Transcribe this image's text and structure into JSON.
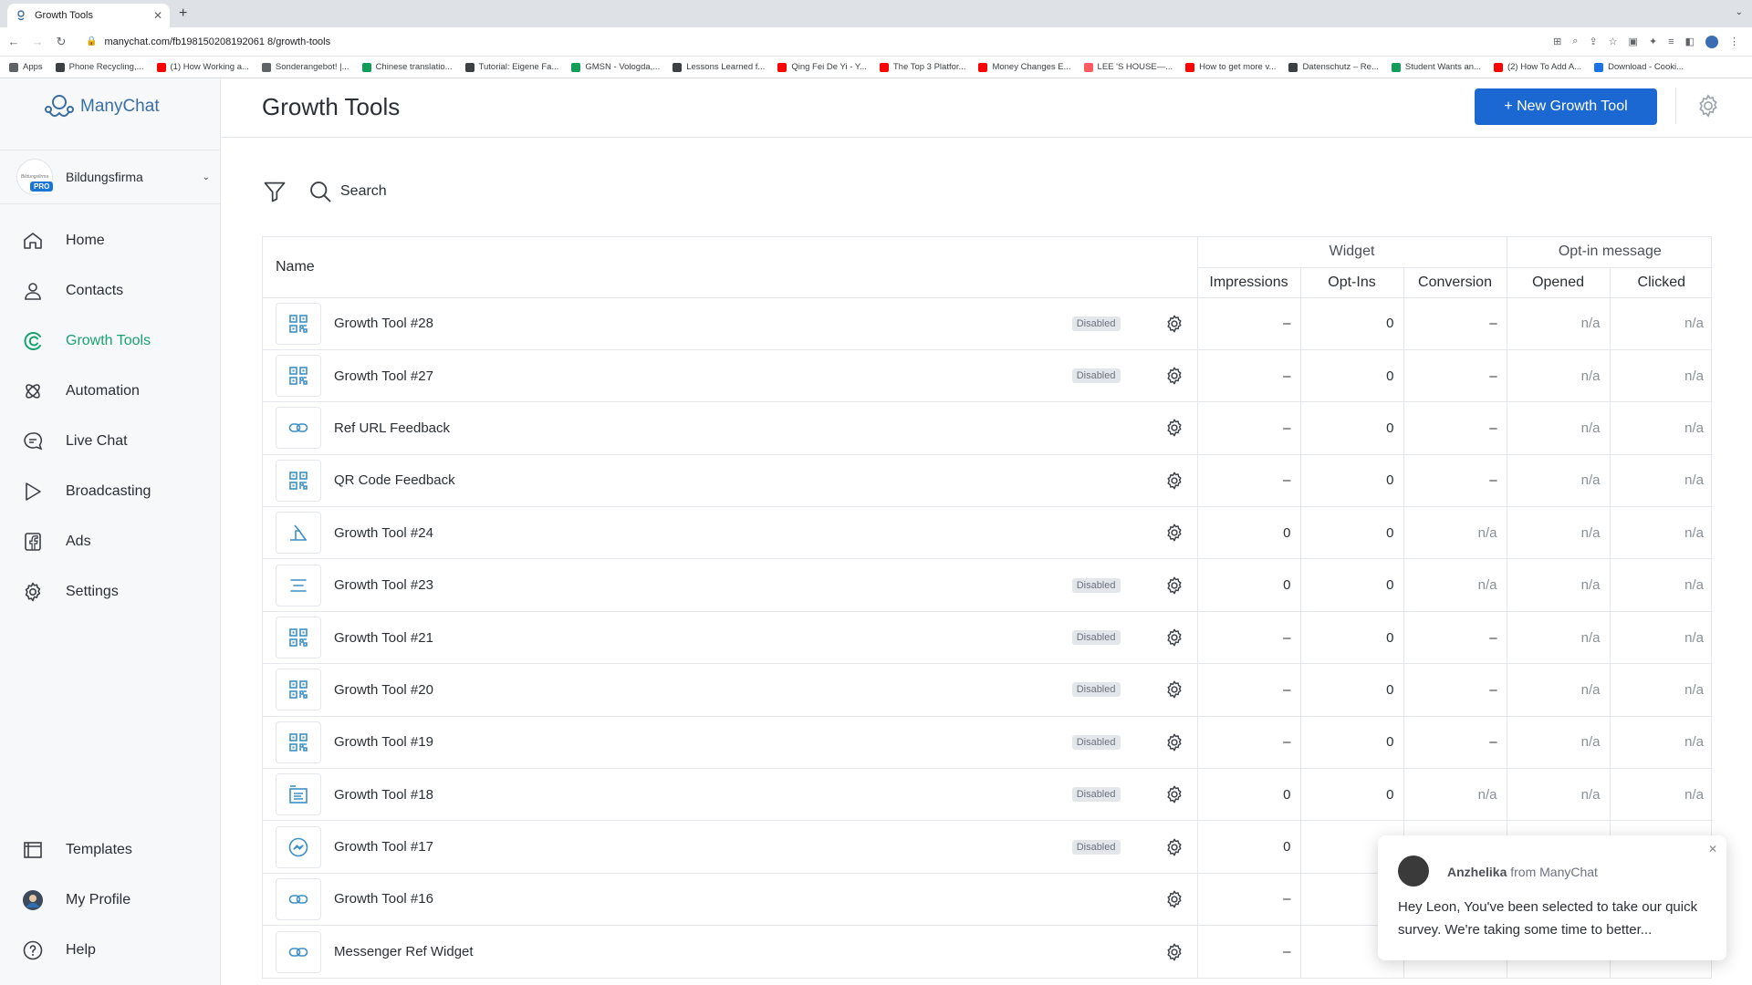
{
  "browser": {
    "tab_title": "Growth Tools",
    "url": "manychat.com/fb198150208192061 8/growth-tools",
    "bookmarks": [
      {
        "label": "Apps",
        "color": "#5f6368"
      },
      {
        "label": "Phone Recycling,...",
        "color": "#3c4043"
      },
      {
        "label": "(1) How Working a...",
        "color": "#ff0000"
      },
      {
        "label": "Sonderangebot! |...",
        "color": "#5f6368"
      },
      {
        "label": "Chinese translatio...",
        "color": "#0f9d58"
      },
      {
        "label": "Tutorial: Eigene Fa...",
        "color": "#3c4043"
      },
      {
        "label": "GMSN - Vologda,...",
        "color": "#0f9d58"
      },
      {
        "label": "Lessons Learned f...",
        "color": "#3c4043"
      },
      {
        "label": "Qing Fei De Yi - Y...",
        "color": "#ff0000"
      },
      {
        "label": "The Top 3 Platfor...",
        "color": "#ff0000"
      },
      {
        "label": "Money Changes E...",
        "color": "#ff0000"
      },
      {
        "label": "LEE 'S HOUSE—...",
        "color": "#ff5a5f"
      },
      {
        "label": "How to get more v...",
        "color": "#ff0000"
      },
      {
        "label": "Datenschutz – Re...",
        "color": "#3c4043"
      },
      {
        "label": "Student Wants an...",
        "color": "#0f9d58"
      },
      {
        "label": "(2) How To Add A...",
        "color": "#ff0000"
      },
      {
        "label": "Download - Cooki...",
        "color": "#1a73e8"
      }
    ]
  },
  "sidebar": {
    "brand": "ManyChat",
    "account": {
      "name": "Bildungsfirma",
      "badge": "PRO",
      "logo_text": "Bildungsfirma"
    },
    "nav": [
      {
        "label": "Home",
        "icon": "home-icon"
      },
      {
        "label": "Contacts",
        "icon": "user-icon"
      },
      {
        "label": "Growth Tools",
        "icon": "growth-icon",
        "active": true
      },
      {
        "label": "Automation",
        "icon": "automation-icon"
      },
      {
        "label": "Live Chat",
        "icon": "chat-icon"
      },
      {
        "label": "Broadcasting",
        "icon": "send-icon"
      },
      {
        "label": "Ads",
        "icon": "facebook-icon"
      },
      {
        "label": "Settings",
        "icon": "gear-icon"
      }
    ],
    "nav_bottom": [
      {
        "label": "Templates",
        "icon": "templates-icon"
      },
      {
        "label": "My Profile",
        "icon": "profile-avatar"
      },
      {
        "label": "Help",
        "icon": "help-icon"
      }
    ]
  },
  "page": {
    "title": "Growth Tools",
    "new_button": "+ New Growth Tool",
    "search_label": "Search"
  },
  "table": {
    "name_header": "Name",
    "groups": [
      "Widget",
      "Opt-in message"
    ],
    "columns": [
      "Impressions",
      "Opt-Ins",
      "Conversion",
      "Opened",
      "Clicked"
    ],
    "rows": [
      {
        "name": "Growth Tool #28",
        "icon": "qr-code-icon",
        "disabled": "Disabled",
        "impressions": "–",
        "optins": "0",
        "conversion": "–",
        "opened": "n/a",
        "clicked": "n/a"
      },
      {
        "name": "Growth Tool #27",
        "icon": "qr-code-icon",
        "disabled": "Disabled",
        "impressions": "–",
        "optins": "0",
        "conversion": "–",
        "opened": "n/a",
        "clicked": "n/a"
      },
      {
        "name": "Ref URL Feedback",
        "icon": "link-icon",
        "disabled": "",
        "impressions": "–",
        "optins": "0",
        "conversion": "–",
        "opened": "n/a",
        "clicked": "n/a"
      },
      {
        "name": "QR Code Feedback",
        "icon": "qr-code-icon",
        "disabled": "",
        "impressions": "–",
        "optins": "0",
        "conversion": "–",
        "opened": "n/a",
        "clicked": "n/a"
      },
      {
        "name": "Growth Tool #24",
        "icon": "landing-page-icon",
        "disabled": "",
        "impressions": "0",
        "optins": "0",
        "conversion": "n/a",
        "opened": "n/a",
        "clicked": "n/a"
      },
      {
        "name": "Growth Tool #23",
        "icon": "bar-widget-icon",
        "disabled": "Disabled",
        "impressions": "0",
        "optins": "0",
        "conversion": "n/a",
        "opened": "n/a",
        "clicked": "n/a"
      },
      {
        "name": "Growth Tool #21",
        "icon": "qr-code-icon",
        "disabled": "Disabled",
        "impressions": "–",
        "optins": "0",
        "conversion": "–",
        "opened": "n/a",
        "clicked": "n/a"
      },
      {
        "name": "Growth Tool #20",
        "icon": "qr-code-icon",
        "disabled": "Disabled",
        "impressions": "–",
        "optins": "0",
        "conversion": "–",
        "opened": "n/a",
        "clicked": "n/a"
      },
      {
        "name": "Growth Tool #19",
        "icon": "qr-code-icon",
        "disabled": "Disabled",
        "impressions": "–",
        "optins": "0",
        "conversion": "–",
        "opened": "n/a",
        "clicked": "n/a"
      },
      {
        "name": "Growth Tool #18",
        "icon": "form-icon",
        "disabled": "Disabled",
        "impressions": "0",
        "optins": "0",
        "conversion": "n/a",
        "opened": "n/a",
        "clicked": "n/a"
      },
      {
        "name": "Growth Tool #17",
        "icon": "messenger-icon",
        "disabled": "Disabled",
        "impressions": "0",
        "optins": "",
        "conversion": "",
        "opened": "",
        "clicked": ""
      },
      {
        "name": "Growth Tool #16",
        "icon": "link-icon",
        "disabled": "",
        "impressions": "–",
        "optins": "",
        "conversion": "",
        "opened": "",
        "clicked": ""
      },
      {
        "name": "Messenger Ref Widget",
        "icon": "link-icon",
        "disabled": "",
        "impressions": "–",
        "optins": "",
        "conversion": "",
        "opened": "",
        "clicked": ""
      }
    ]
  },
  "chat_popup": {
    "agent": "Anzhelika",
    "from_text": "from ManyChat",
    "message": "Hey Leon,  You've been selected to take our quick survey. We're taking some time to better..."
  },
  "colors": {
    "brand_blue": "#1b68d2",
    "active_green": "#18a26e",
    "icon_blue": "#3b8fc6"
  }
}
